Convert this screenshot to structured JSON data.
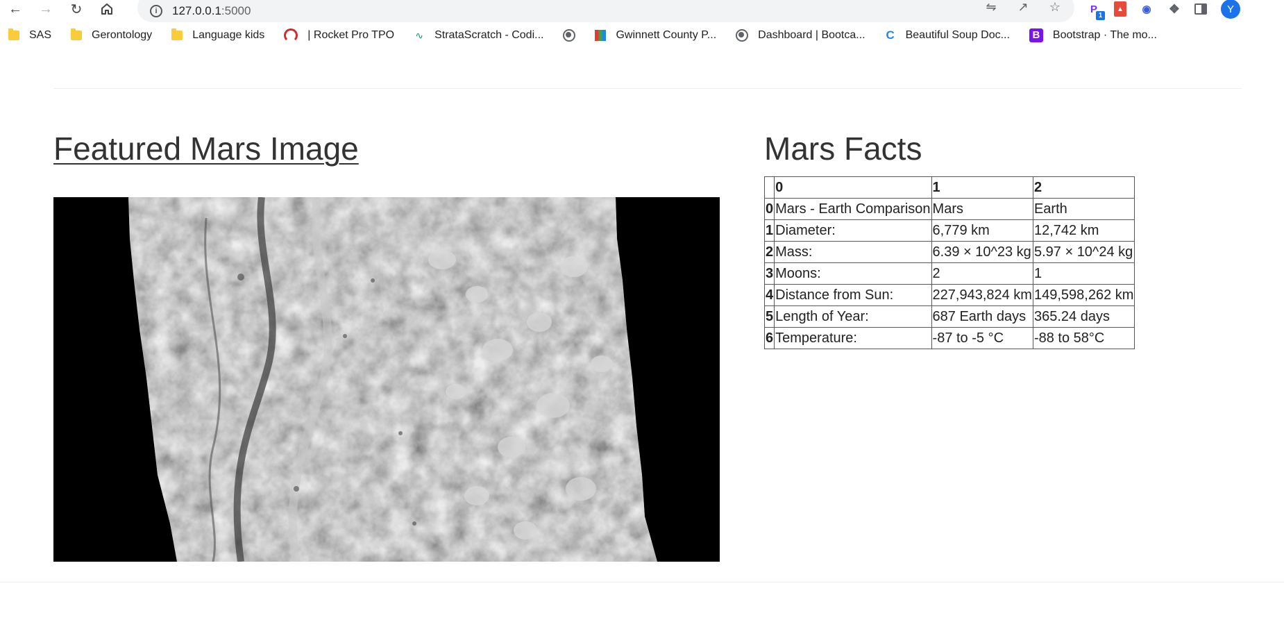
{
  "browser": {
    "url_host": "127.0.0.1",
    "url_port": ":5000",
    "profile_initial": "Y",
    "extension_badge": "1",
    "bookmarks": [
      {
        "label": "SAS",
        "icon": "folder-icon"
      },
      {
        "label": "Gerontology",
        "icon": "folder-icon"
      },
      {
        "label": "Language kids",
        "icon": "folder-icon"
      },
      {
        "label": "| Rocket Pro TPO",
        "icon": "rocket-icon"
      },
      {
        "label": "StrataScratch - Codi...",
        "icon": "strata-icon"
      },
      {
        "label": "",
        "icon": "globe-icon"
      },
      {
        "label": "Gwinnett County P...",
        "icon": "gwinnett-icon"
      },
      {
        "label": "Dashboard | Bootca...",
        "icon": "globe-icon"
      },
      {
        "label": "Beautiful Soup Doc...",
        "icon": "c-icon"
      },
      {
        "label": "Bootstrap · The mo...",
        "icon": "bootstrap-icon"
      }
    ]
  },
  "page": {
    "image_section_title": "Featured Mars Image",
    "facts_section_title": "Mars Facts"
  },
  "facts_table": {
    "headers": [
      "",
      "0",
      "1",
      "2"
    ],
    "rows": [
      {
        "index": "0",
        "cells": [
          "Mars - Earth Comparison",
          "Mars",
          "Earth"
        ]
      },
      {
        "index": "1",
        "cells": [
          "Diameter:",
          "6,779 km",
          "12,742 km"
        ]
      },
      {
        "index": "2",
        "cells": [
          "Mass:",
          "6.39 × 10^23 kg",
          "5.97 × 10^24 kg"
        ]
      },
      {
        "index": "3",
        "cells": [
          "Moons:",
          "2",
          "1"
        ]
      },
      {
        "index": "4",
        "cells": [
          "Distance from Sun:",
          "227,943,824 km",
          "149,598,262 km"
        ]
      },
      {
        "index": "5",
        "cells": [
          "Length of Year:",
          "687 Earth days",
          "365.24 days"
        ]
      },
      {
        "index": "6",
        "cells": [
          "Temperature:",
          "-87 to -5 °C",
          "-88 to 58°C"
        ]
      }
    ]
  }
}
